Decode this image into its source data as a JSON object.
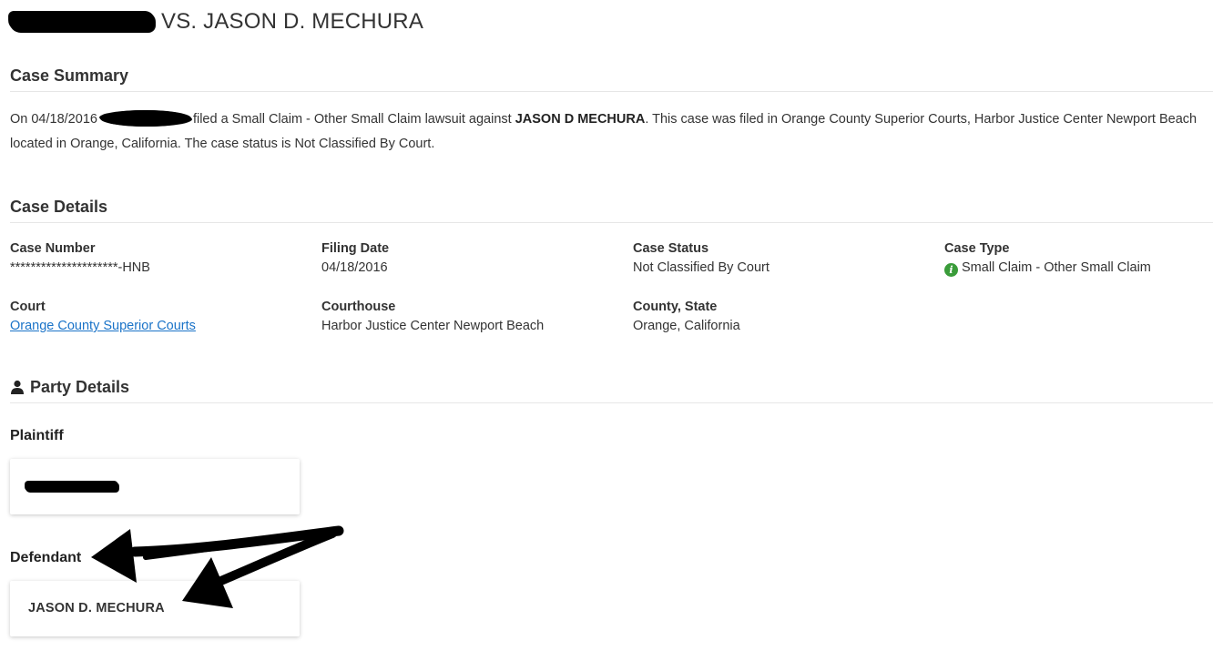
{
  "case_title": {
    "versus_text": "VS. JASON D. MECHURA"
  },
  "summary": {
    "heading": "Case Summary",
    "text_prefix": "On 04/18/2016",
    "text_middle": "filed a Small Claim - Other Small Claim lawsuit against",
    "defendant_bold": "JASON D MECHURA",
    "text_suffix": ". This case was filed in Orange County Superior Courts, Harbor Justice Center Newport Beach located in Orange, California. The case status is Not Classified By Court."
  },
  "details": {
    "heading": "Case Details",
    "case_number_label": "Case Number",
    "case_number_value": "*********************-HNB",
    "filing_date_label": "Filing Date",
    "filing_date_value": "04/18/2016",
    "case_status_label": "Case Status",
    "case_status_value": "Not Classified By Court",
    "case_type_label": "Case Type",
    "case_type_value": "Small Claim - Other Small Claim",
    "court_label": "Court",
    "court_value": "Orange County Superior Courts",
    "courthouse_label": "Courthouse",
    "courthouse_value": "Harbor Justice Center Newport Beach",
    "county_state_label": "County, State",
    "county_state_value": "Orange, California"
  },
  "party": {
    "heading": "Party Details",
    "plaintiff_label": "Plaintiff",
    "defendant_label": "Defendant",
    "defendant_name": "JASON D. MECHURA"
  },
  "icons": {
    "info": "info-icon",
    "person": "person-icon"
  },
  "colors": {
    "link": "#1a73c8",
    "info_icon": "#3a9c3a",
    "text": "#333333",
    "rule": "#e6e6e6"
  }
}
